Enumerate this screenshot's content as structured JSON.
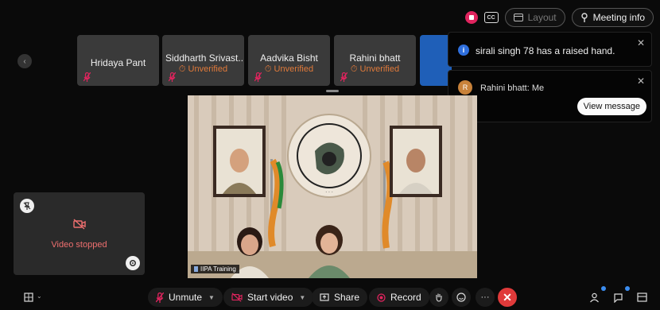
{
  "topbar": {
    "cc_label": "CC",
    "layout_label": "Layout",
    "meeting_info_label": "Meeting info"
  },
  "participants": [
    {
      "name": "Hridaya Pant",
      "status": ""
    },
    {
      "name": "Siddharth Srivast...",
      "status": "Unverified"
    },
    {
      "name": "Aadvika Bisht",
      "status": "Unverified"
    },
    {
      "name": "Rahini bhatt",
      "status": "Unverified"
    }
  ],
  "notifications": {
    "raised_hand": {
      "text": "sirali singh 78 has a raised hand."
    },
    "message": {
      "avatar": "R",
      "text": "Rahini bhatt: Me",
      "button": "View message"
    }
  },
  "main_video": {
    "label": "IIPA Training"
  },
  "self_view": {
    "status": "Video stopped"
  },
  "toolbar": {
    "unmute": "Unmute",
    "start_video": "Start video",
    "share": "Share",
    "record": "Record",
    "more": "···"
  },
  "colors": {
    "unverified": "#e07a3a",
    "record_red": "#e0245e",
    "end_red": "#e03a3a",
    "stopped_red": "#ee6f6f"
  }
}
